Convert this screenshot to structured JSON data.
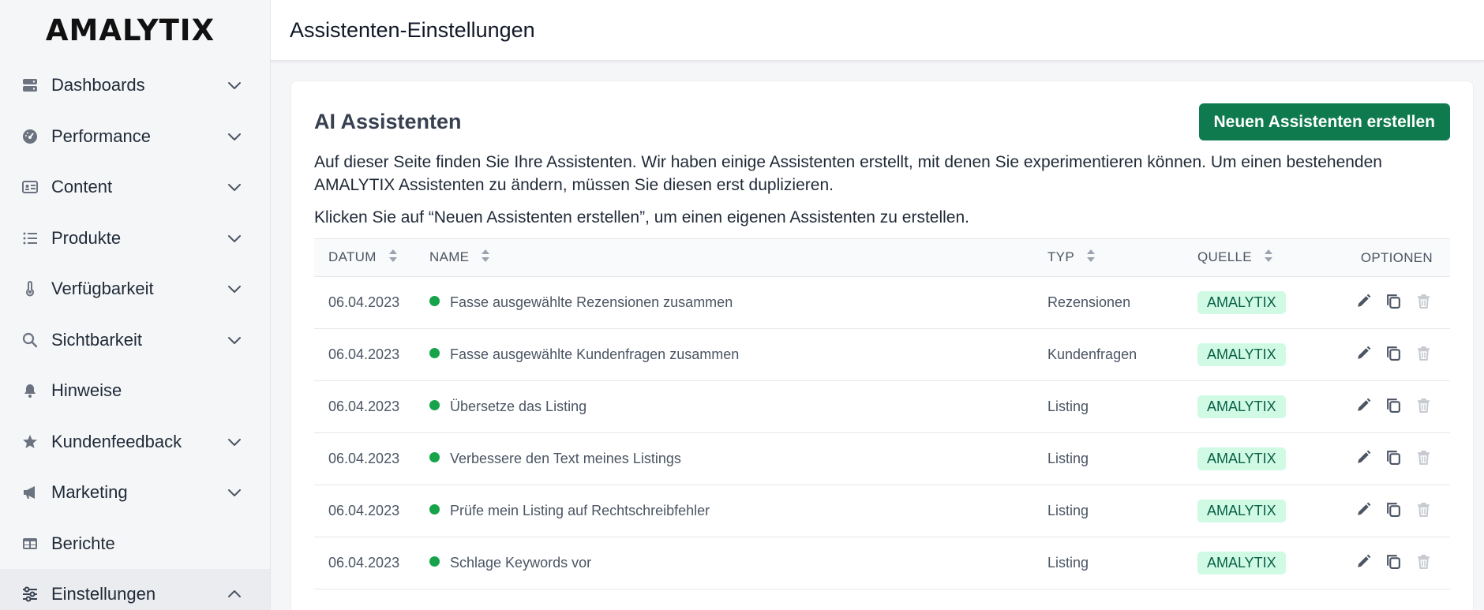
{
  "app": {
    "logo": "AMALYTIX"
  },
  "sidebar": {
    "items": [
      {
        "label": "Dashboards",
        "icon": "server-icon",
        "expand": "down"
      },
      {
        "label": "Performance",
        "icon": "gauge-icon",
        "expand": "down"
      },
      {
        "label": "Content",
        "icon": "id-card-icon",
        "expand": "down"
      },
      {
        "label": "Produkte",
        "icon": "list-icon",
        "expand": "down"
      },
      {
        "label": "Verfügbarkeit",
        "icon": "thermometer-icon",
        "expand": "down"
      },
      {
        "label": "Sichtbarkeit",
        "icon": "search-icon",
        "expand": "down"
      },
      {
        "label": "Hinweise",
        "icon": "bell-icon",
        "expand": ""
      },
      {
        "label": "Kundenfeedback",
        "icon": "star-icon",
        "expand": "down"
      },
      {
        "label": "Marketing",
        "icon": "megaphone-icon",
        "expand": "down"
      },
      {
        "label": "Berichte",
        "icon": "table-icon",
        "expand": ""
      },
      {
        "label": "Einstellungen",
        "icon": "sliders-icon",
        "expand": "up",
        "active": true
      }
    ]
  },
  "header": {
    "title": "Assistenten-Einstellungen"
  },
  "card": {
    "title": "AI Assistenten",
    "new_button": "Neuen Assistenten erstellen",
    "description": "Auf dieser Seite finden Sie Ihre Assistenten. Wir haben einige Assistenten erstellt, mit denen Sie experimentieren können. Um einen bestehenden AMALYTIX Assistenten zu ändern, müssen Sie diesen erst duplizieren.",
    "hint": "Klicken Sie auf “Neuen Assistenten erstellen”, um einen eigenen Assistenten zu erstellen."
  },
  "table": {
    "columns": {
      "date": "DATUM",
      "name": "NAME",
      "type": "TYP",
      "source": "QUELLE",
      "options": "OPTIONEN"
    },
    "rows": [
      {
        "date": "06.04.2023",
        "name": "Fasse ausgewählte Rezensionen zusammen",
        "type": "Rezensionen",
        "source": "AMALYTIX"
      },
      {
        "date": "06.04.2023",
        "name": "Fasse ausgewählte Kundenfragen zusammen",
        "type": "Kundenfragen",
        "source": "AMALYTIX"
      },
      {
        "date": "06.04.2023",
        "name": "Übersetze das Listing",
        "type": "Listing",
        "source": "AMALYTIX"
      },
      {
        "date": "06.04.2023",
        "name": "Verbessere den Text meines Listings",
        "type": "Listing",
        "source": "AMALYTIX"
      },
      {
        "date": "06.04.2023",
        "name": "Prüfe mein Listing auf Rechtschreibfehler",
        "type": "Listing",
        "source": "AMALYTIX"
      },
      {
        "date": "06.04.2023",
        "name": "Schlage Keywords vor",
        "type": "Listing",
        "source": "AMALYTIX"
      }
    ]
  },
  "colors": {
    "primary": "#0f7a4e",
    "status_dot": "#16a34a",
    "badge_bg": "#d1fae5",
    "badge_text": "#065f46"
  }
}
